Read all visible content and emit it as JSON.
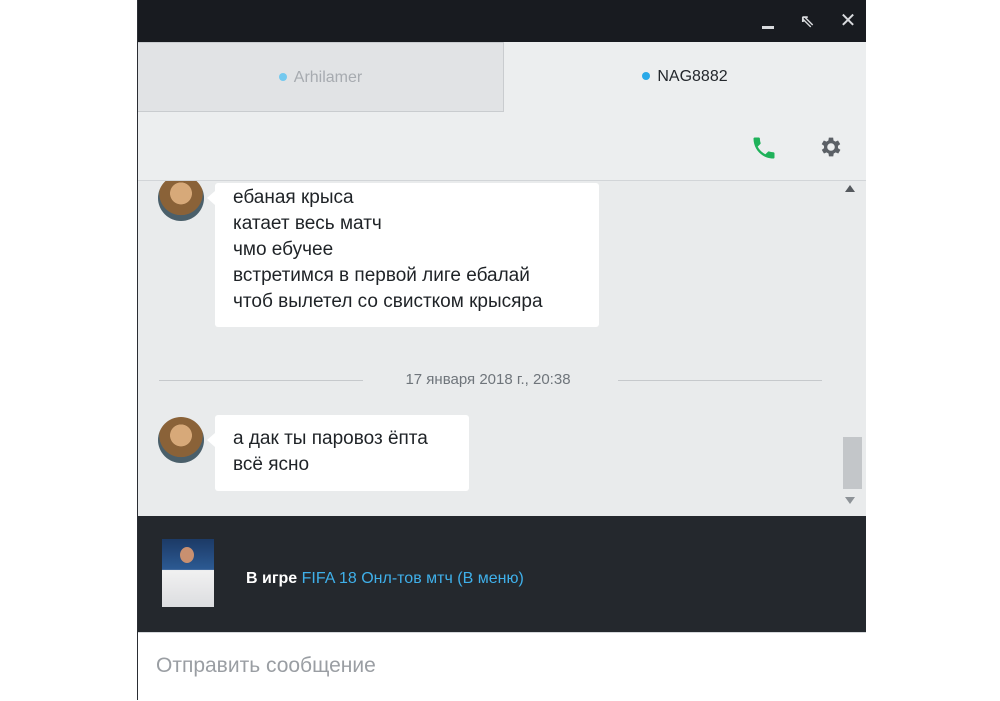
{
  "window": {
    "controls": {
      "minimize_icon": "minimize-icon",
      "restore_icon": "restore-arrow-icon",
      "close_glyph": "✕",
      "restore_glyph": "⇖"
    }
  },
  "tabs": [
    {
      "label": "Arhilamer",
      "status_color": "#74c9ef",
      "active": false
    },
    {
      "label": "NAG8882",
      "status_color": "#2aa9e8",
      "active": true
    }
  ],
  "actions": {
    "call_icon": "phone-icon",
    "call_color": "#1fb25a",
    "settings_icon": "gear-icon"
  },
  "messages": {
    "groups": [
      {
        "avatar": "dwarf-avatar",
        "lines": [
          "ебаная крыса",
          "катает весь матч",
          "чмо ебучее",
          "встретимся в первой лиге ебалай",
          "чтоб вылетел со свистком крысяра"
        ]
      },
      {
        "avatar": "dwarf-avatar",
        "lines": [
          "а дак ты паровоз ёпта",
          "всё ясно"
        ]
      }
    ],
    "separator": "17 января 2018 г., 20:38"
  },
  "game_status": {
    "label": "В игре",
    "title": "FIFA 18 Онл-тов мтч (В меню)",
    "title_color": "#3fb0ea"
  },
  "input": {
    "placeholder": "Отправить сообщение",
    "value": ""
  }
}
